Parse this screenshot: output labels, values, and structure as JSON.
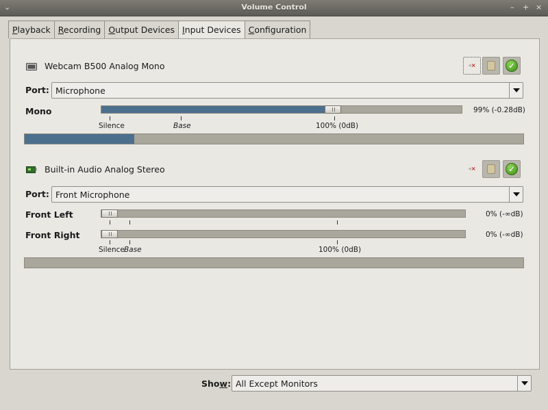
{
  "window": {
    "title": "Volume Control"
  },
  "tabs": [
    {
      "mnemonic": "P",
      "rest": "layback"
    },
    {
      "mnemonic": "R",
      "rest": "ecording"
    },
    {
      "mnemonic": "O",
      "rest": "utput Devices"
    },
    {
      "mnemonic": "I",
      "rest": "nput Devices"
    },
    {
      "mnemonic": "C",
      "rest": "onfiguration"
    }
  ],
  "active_tab": "Input Devices",
  "devices": [
    {
      "name": "Webcam B500 Analog Mono",
      "port_label": "Port:",
      "port_value": "Microphone",
      "channels": [
        {
          "name": "Mono",
          "volume_percent": 99,
          "volume_text": "99% (-0.28dB)"
        }
      ],
      "scale_labels": {
        "silence": "Silence",
        "base": "Base",
        "hundred": "100% (0dB)"
      },
      "peak_level": 0.22
    },
    {
      "name": "Built-in Audio Analog Stereo",
      "port_label": "Port:",
      "port_value": "Front Microphone",
      "channels": [
        {
          "name": "Front Left",
          "volume_percent": 0,
          "volume_text": "0% (-∞dB)"
        },
        {
          "name": "Front Right",
          "volume_percent": 0,
          "volume_text": "0% (-∞dB)"
        }
      ],
      "scale_labels": {
        "silence": "Silence",
        "base": "Base",
        "hundred": "100% (0dB)"
      },
      "peak_level": 0
    }
  ],
  "show": {
    "label_pre": "Sho",
    "label_mnemonic": "w",
    "label_post": ":",
    "value": "All Except Monitors"
  },
  "colors": {
    "fill": "#4d6f8e",
    "accent_green": "#3c8f18"
  }
}
